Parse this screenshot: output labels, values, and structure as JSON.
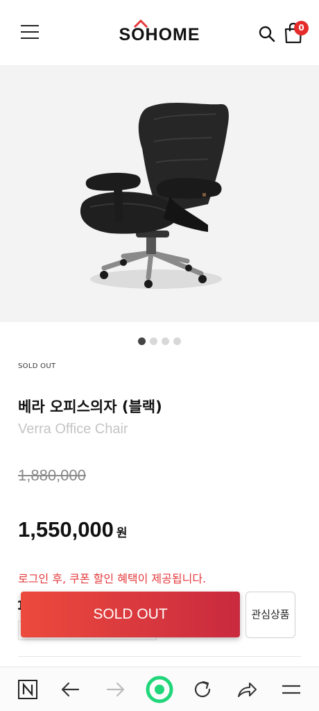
{
  "header": {
    "logo_text": "SOHOME",
    "cart_count": "0"
  },
  "gallery": {
    "slide_count": 4,
    "active_index": 0
  },
  "product": {
    "status_tag": "SOLD OUT",
    "name_ko": "베라 오피스의자 (블랙)",
    "name_en": "Verra Office Chair",
    "original_price": "1,880,000",
    "sale_price": "1,550,000",
    "currency_unit": "원",
    "coupon_notice": "로그인 후, 쿠폰 할인 혜택이 제공됩니다."
  },
  "actions": {
    "soldout_label": "SOLD OUT",
    "wishlist_label": "관심상품"
  },
  "colors": {
    "accent_red": "#e5383b",
    "badge_red": "#e62b2b",
    "browser_green": "#1fd67a"
  },
  "browser_bar": {
    "items": [
      "naver-n-icon",
      "back-arrow-icon",
      "forward-arrow-icon",
      "green-home-icon",
      "refresh-icon",
      "share-icon",
      "menu-icon"
    ]
  }
}
